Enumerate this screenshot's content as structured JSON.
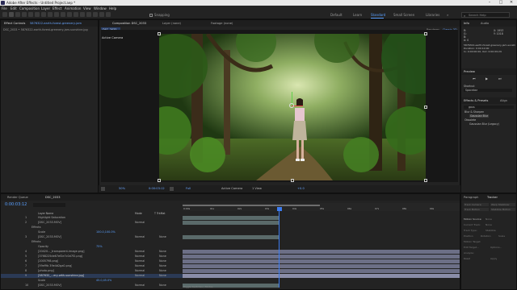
{
  "app": {
    "title": "Adobe After Effects - Untitled Project.aep *",
    "window_controls": [
      "–",
      "□",
      "✕"
    ]
  },
  "menu": [
    "File",
    "Edit",
    "Composition",
    "Layer",
    "Effect",
    "Animation",
    "View",
    "Window",
    "Help"
  ],
  "toolbar": {
    "snapping_label": "Snapping",
    "workspaces": [
      "Default",
      "Learn",
      "Standard",
      "Small Screen",
      "Libraries"
    ],
    "active_workspace": "Standard",
    "search_placeholder": "Search Help"
  },
  "project_panel": {
    "tab": "Effect Controls",
    "tab_file": "5876322-earth-forest-greenery-jam",
    "subtitle": "DSC_2033 • 5876322-earth-forest-greenery-jam-sunshine.jpg"
  },
  "comp_panel": {
    "tabs": [
      "Composition DSC_2033",
      "Layer (none)",
      "Footage (none)"
    ],
    "comp_name": "DSC_2033",
    "active_camera": "Active Camera",
    "renderer_label": "Renderer:",
    "renderer_value": "Classic 3D",
    "viewer_zoom": "50%",
    "viewer_time": "0:00:03:12",
    "viewer_resolution": "Full",
    "viewer_camera": "Active Camera",
    "viewer_views": "1 View",
    "viewer_offset": "+0.0"
  },
  "right_panel": {
    "info_tab": "Info",
    "audio_tab": "Audio",
    "info_values": [
      "R:",
      "G:",
      "B:",
      "A: 0"
    ],
    "info_coords": [
      "X: 1953",
      "Y: 1018"
    ],
    "info_file": "5876322-earth-forest-greenery-jam-sunshine.jpg",
    "info_duration": "Duration: 0:00:10:00",
    "info_inout": "In: 0:00:00:00, Out: 0:00:09:29",
    "preview_tab": "Preview",
    "shortcut_label": "Shortcut",
    "shortcut_value": "Spacebar",
    "effects_tab": "Effects & Presets",
    "effects_search": "gaus",
    "effects_items": [
      "Blur & Sharpen",
      "Gaussian Blur",
      "Obsolete",
      "Gaussian Blur (Legacy)"
    ],
    "align_tab": "Align",
    "libraries_tab": "Libraries"
  },
  "paragraph_panel": {
    "tabs": [
      "Paragraph",
      "Tracker"
    ],
    "buttons": [
      "Track Camera",
      "Warp Stabilizer",
      "Track Motion",
      "Stabilize Motion"
    ],
    "motion_source_label": "Motion Source:",
    "motion_source_value": "None",
    "current_track_label": "Current Track:",
    "current_track_value": "None",
    "track_type_label": "Track Type:",
    "track_type_value": "Stabilize",
    "options": [
      "Position",
      "Rotation",
      "Scale"
    ],
    "motion_target_label": "Motion Target:",
    "actions": [
      "Edit Target...",
      "Options...",
      "Analyze:",
      "Reset",
      "Apply"
    ]
  },
  "timeline": {
    "tabs": [
      "Render Queue",
      "DSC_2033"
    ],
    "timecode": "0:00:03:12",
    "column_headers": [
      "Layer Name",
      "Mode",
      "T TrkMat"
    ],
    "ruler": [
      "0:00s",
      "01s",
      "02s",
      "03s",
      "04s",
      "05s",
      "06s",
      "07s",
      "08s",
      "09s"
    ],
    "layers": [
      {
        "num": "1",
        "name": "Highlight Saturation",
        "mode": "",
        "trk": ""
      },
      {
        "num": "2",
        "name": "[DSC_2033.MOV]",
        "mode": "Normal",
        "trk": ""
      },
      {
        "num": "",
        "name": "Effects",
        "mode": "",
        "trk": ""
      },
      {
        "num": "",
        "name": "Scale",
        "mode": "",
        "trk": ""
      },
      {
        "num": "3",
        "name": "[DSC_2033.MOV]",
        "mode": "Normal",
        "trk": "None"
      },
      {
        "num": "",
        "name": "Effects",
        "mode": "",
        "trk": ""
      },
      {
        "num": "",
        "name": "Opacity",
        "mode": "",
        "trk": ""
      },
      {
        "num": "4",
        "name": "[20420..._transparent-image.png]",
        "mode": "Normal",
        "trk": "None"
      },
      {
        "num": "5",
        "name": "[3768225de67ef2e7c0d7f2.png]",
        "mode": "Normal",
        "trk": "None"
      },
      {
        "num": "6",
        "name": "[2005798.png]",
        "mode": "Normal",
        "trk": "None"
      },
      {
        "num": "7",
        "name": "[59ef9b 39e4d2ga0.png]",
        "mode": "Normal",
        "trk": "None"
      },
      {
        "num": "8",
        "name": "[photo.png]",
        "mode": "Normal",
        "trk": "None"
      },
      {
        "num": "9",
        "name": "[587632_...ery-with-sunshine.jpg]",
        "mode": "Normal",
        "trk": "None"
      },
      {
        "num": "",
        "name": "Scale",
        "mode": "",
        "trk": ""
      },
      {
        "num": "10",
        "name": "[DSC_2033.MOV]",
        "mode": "Normal",
        "trk": "None"
      }
    ],
    "scale_values": [
      "100.0,100.0%",
      "45.0,45.0%"
    ],
    "opacity_value": "75%",
    "footer": "Toggle Switches / Modes"
  }
}
